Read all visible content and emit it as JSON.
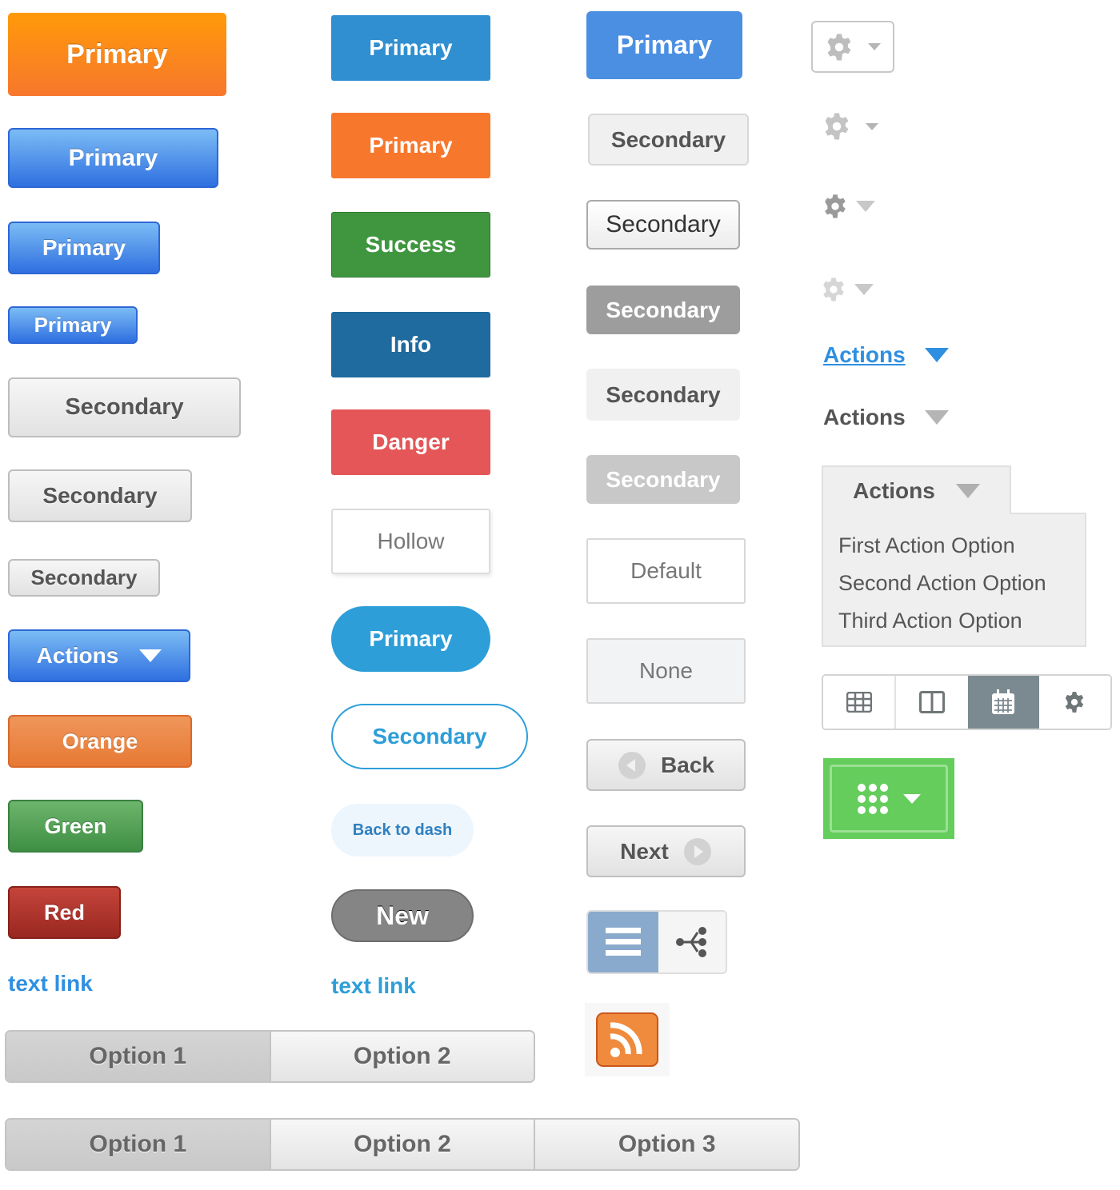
{
  "column1": {
    "primary_large": "Primary",
    "primary_gradient_1": "Primary",
    "primary_gradient_2": "Primary",
    "primary_gradient_3": "Primary",
    "secondary_1": "Secondary",
    "secondary_2": "Secondary",
    "secondary_3": "Secondary",
    "actions": "Actions",
    "orange": "Orange",
    "green": "Green",
    "red": "Red",
    "text_link": "text link"
  },
  "column2": {
    "primary_blue": "Primary",
    "primary_orange": "Primary",
    "success": "Success",
    "info": "Info",
    "danger": "Danger",
    "hollow": "Hollow",
    "primary_pill": "Primary",
    "secondary_pill": "Secondary",
    "back_to_dash": "Back to dash",
    "new": "New",
    "text_link": "text link"
  },
  "column3": {
    "primary": "Primary",
    "secondary_1": "Secondary",
    "secondary_2": "Secondary",
    "secondary_3": "Secondary",
    "secondary_4": "Secondary",
    "secondary_5": "Secondary",
    "default": "Default",
    "none": "None",
    "back": "Back",
    "next": "Next",
    "view_toggle": {
      "icons": [
        "list-icon",
        "tree-icon"
      ],
      "active": 0
    },
    "rss_icon": "rss-icon"
  },
  "column4": {
    "gear_dropdowns": [
      "gear-icon",
      "gear-icon",
      "gear-icon",
      "gear-icon"
    ],
    "actions_link": "Actions",
    "actions_plain": "Actions",
    "actions_menu": {
      "label": "Actions",
      "options": [
        "First Action Option",
        "Second Action Option",
        "Third Action Option"
      ]
    },
    "icon_toolbar": {
      "icons": [
        "grid-icon",
        "split-view-icon",
        "calendar-icon",
        "gear-icon"
      ],
      "active": 2
    },
    "apps_button_icon": "apps-grid-icon"
  },
  "segmented": {
    "two": {
      "options": [
        "Option 1",
        "Option 2"
      ],
      "active": 0
    },
    "three": {
      "options": [
        "Option 1",
        "Option 2",
        "Option 3"
      ],
      "active": 0
    }
  },
  "colors": {
    "orange": "#f7772c",
    "blue": "#2f8fd0",
    "success": "#3f963f",
    "info": "#1f6a9e",
    "danger": "#e45657",
    "pill_blue": "#2d9ed8",
    "link_blue": "#2f8fe0",
    "green_apps": "#64cd5c",
    "toolbar_active": "#7b8a90"
  }
}
